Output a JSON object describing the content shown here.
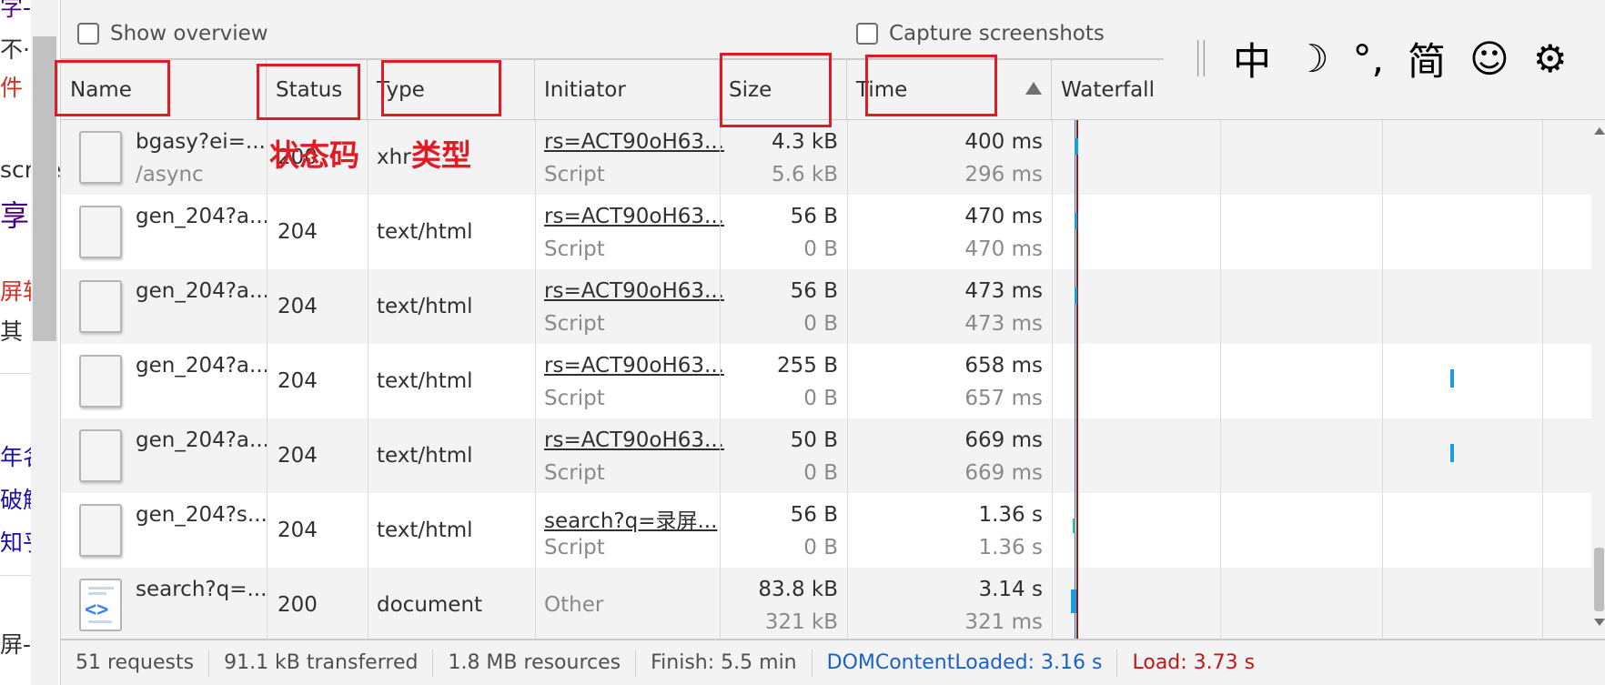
{
  "left_page": {
    "fragments": [
      {
        "text": "字-",
        "color": "#4b0082"
      },
      {
        "text": "不·",
        "color": "#303030"
      },
      {
        "text": "件",
        "color": "#d93025"
      },
      {
        "text": "scree",
        "color": "#303030"
      },
      {
        "text": "享",
        "color": "#4b0082"
      },
      {
        "text": "屏软",
        "color": "#d93025"
      },
      {
        "text": "其",
        "color": "#303030"
      },
      {
        "text": "年名",
        "color": "#1a0dab"
      },
      {
        "text": "破解",
        "color": "#1a0dab"
      },
      {
        "text": "知乎",
        "color": "#1a0dab"
      },
      {
        "text": "屏-月",
        "color": "#303030"
      }
    ]
  },
  "options": {
    "show_overview": "Show overview",
    "capture_screenshots": "Capture screenshots"
  },
  "ime_bar": {
    "items": [
      {
        "icon": "chinese-mode-icon",
        "glyph": "中"
      },
      {
        "icon": "moon-icon",
        "glyph": "☽"
      },
      {
        "icon": "punctuation-icon",
        "glyph": "°,"
      },
      {
        "icon": "simplified-icon",
        "glyph": "简"
      },
      {
        "icon": "emoji-icon",
        "glyph": "☺"
      },
      {
        "icon": "gear-icon",
        "glyph": "⚙"
      }
    ]
  },
  "columns": {
    "name": "Name",
    "status": "Status",
    "type": "Type",
    "initiator": "Initiator",
    "size": "Size",
    "time": "Time",
    "waterfall": "Waterfall"
  },
  "rows": [
    {
      "name": "bgasy?ei=...",
      "path": "/async",
      "status": "200",
      "type": "xhr",
      "initiator": "rs=ACT90oH63...",
      "initiator_type": "Script",
      "size": "4.3 kB",
      "resource": "5.6 kB",
      "time": "400 ms",
      "latency": "296 ms"
    },
    {
      "name": "gen_204?a...",
      "path": "",
      "status": "204",
      "type": "text/html",
      "initiator": "rs=ACT90oH63...",
      "initiator_type": "Script",
      "size": "56 B",
      "resource": "0 B",
      "time": "470 ms",
      "latency": "470 ms"
    },
    {
      "name": "gen_204?a...",
      "path": "",
      "status": "204",
      "type": "text/html",
      "initiator": "rs=ACT90oH63...",
      "initiator_type": "Script",
      "size": "56 B",
      "resource": "0 B",
      "time": "473 ms",
      "latency": "473 ms"
    },
    {
      "name": "gen_204?a...",
      "path": "",
      "status": "204",
      "type": "text/html",
      "initiator": "rs=ACT90oH63...",
      "initiator_type": "Script",
      "size": "255 B",
      "resource": "0 B",
      "time": "658 ms",
      "latency": "657 ms"
    },
    {
      "name": "gen_204?a...",
      "path": "",
      "status": "204",
      "type": "text/html",
      "initiator": "rs=ACT90oH63...",
      "initiator_type": "Script",
      "size": "50 B",
      "resource": "0 B",
      "time": "669 ms",
      "latency": "669 ms"
    },
    {
      "name": "gen_204?s...",
      "path": "",
      "status": "204",
      "type": "text/html",
      "initiator": "search?q=录屏...",
      "initiator_type": "Script",
      "size": "56 B",
      "resource": "0 B",
      "time": "1.36 s",
      "latency": "1.36 s"
    },
    {
      "name": "search?q=...",
      "path": "",
      "status": "200",
      "type": "document",
      "initiator": "Other",
      "initiator_type": "",
      "size": "83.8 kB",
      "resource": "321 kB",
      "time": "3.14 s",
      "latency": "321 ms"
    }
  ],
  "annotations": {
    "status_label": "状态码",
    "type_label": "类型"
  },
  "statusbar": {
    "requests": "51 requests",
    "transferred": "91.1 kB transferred",
    "resources": "1.8 MB resources",
    "finish": "Finish: 5.5 min",
    "dom_content_loaded": "DOMContentLoaded: 3.16 s",
    "load": "Load: 3.73 s"
  },
  "colors": {
    "dcl": "#1a62c8",
    "load": "#c01818",
    "annotation": "#e01b24",
    "waterfall_bar": "#1a9ce3"
  }
}
